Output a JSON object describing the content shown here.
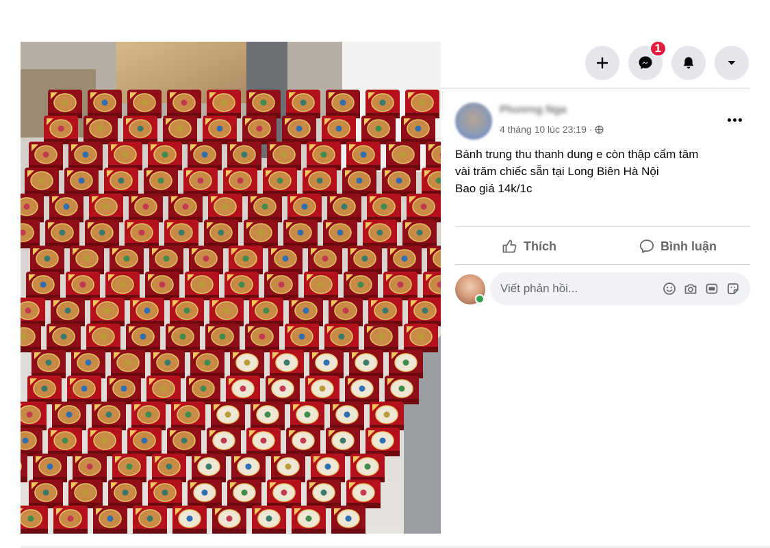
{
  "toolbar": {
    "create_icon": "plus-icon",
    "messenger_icon": "messenger-icon",
    "messenger_badge": "1",
    "notifications_icon": "bell-icon",
    "account_icon": "caret-down-icon"
  },
  "post": {
    "author_name": "Phương Nga",
    "timestamp": "4 tháng 10 lúc 23:19 ·",
    "privacy_icon": "globe-icon",
    "more_icon": "more-dots-icon",
    "text_lines": [
      "Bánh trung thu thanh dung e còn thập cẩm tâm",
      "vài trăm chiếc sẵn tại Long Biên Hà Nội",
      "Bao giá 14k/1c"
    ]
  },
  "actions": {
    "like_label": "Thích",
    "comment_label": "Bình luận"
  },
  "reply": {
    "placeholder": "Viết phản hồi...",
    "icons": [
      "emoji-icon",
      "camera-icon",
      "gif-icon",
      "sticker-icon"
    ]
  },
  "colors": {
    "button_bg": "#e4e6eb",
    "badge": "#e41e3f",
    "secondary_text": "#65676b",
    "online": "#31a24c"
  }
}
